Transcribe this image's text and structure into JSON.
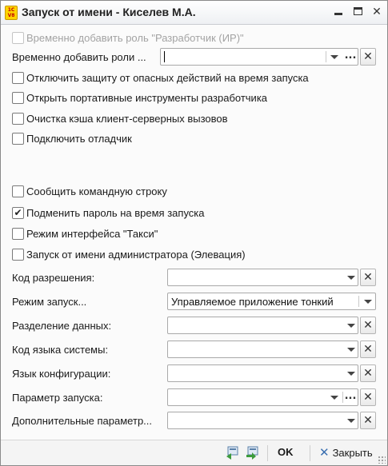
{
  "window": {
    "title": "Запуск от имени - Киселев М.А.",
    "logo_text": "1С\nV8"
  },
  "options_top": [
    {
      "label": "Временно добавить роль \"Разработчик (ИР)\"",
      "checked": false,
      "disabled": true
    }
  ],
  "roles_field": {
    "label": "Временно добавить роли ...",
    "value": ""
  },
  "options_group1": [
    {
      "label": "Отключить защиту от опасных действий на время запуска",
      "checked": false
    },
    {
      "label": "Открыть портативные инструменты разработчика",
      "checked": false
    },
    {
      "label": "Очистка кэша клиент-серверных вызовов",
      "checked": false
    },
    {
      "label": "Подключить отладчик",
      "checked": false
    }
  ],
  "options_group2": [
    {
      "label": "Сообщить командную строку",
      "checked": false
    },
    {
      "label": "Подменить пароль на время запуска",
      "checked": true
    },
    {
      "label": "Режим интерфейса \"Такси\"",
      "checked": false
    },
    {
      "label": "Запуск от имени администратора (Элевация)",
      "checked": false
    }
  ],
  "fields": [
    {
      "label": "Код разрешения:",
      "value": "",
      "has_clear": true,
      "has_dots": false
    },
    {
      "label": "Режим запуск...",
      "value": "Управляемое приложение тонкий",
      "has_clear": false,
      "has_dots": false
    },
    {
      "label": "Разделение данных:",
      "value": "",
      "has_clear": true,
      "has_dots": false
    },
    {
      "label": "Код языка системы:",
      "value": "",
      "has_clear": true,
      "has_dots": false
    },
    {
      "label": "Язык конфигурации:",
      "value": "",
      "has_clear": true,
      "has_dots": false
    },
    {
      "label": "Параметр запуска:",
      "value": "",
      "has_clear": true,
      "has_dots": true
    },
    {
      "label": "Дополнительные параметр...",
      "value": "",
      "has_clear": true,
      "has_dots": false
    }
  ],
  "footer": {
    "ok_label": "OK",
    "close_label": "Закрыть",
    "icons": [
      "save-settings-icon",
      "load-settings-icon"
    ]
  },
  "icons": {
    "dropdown": "triangle-down",
    "clear": "×",
    "dots": "...",
    "check": "✔"
  }
}
